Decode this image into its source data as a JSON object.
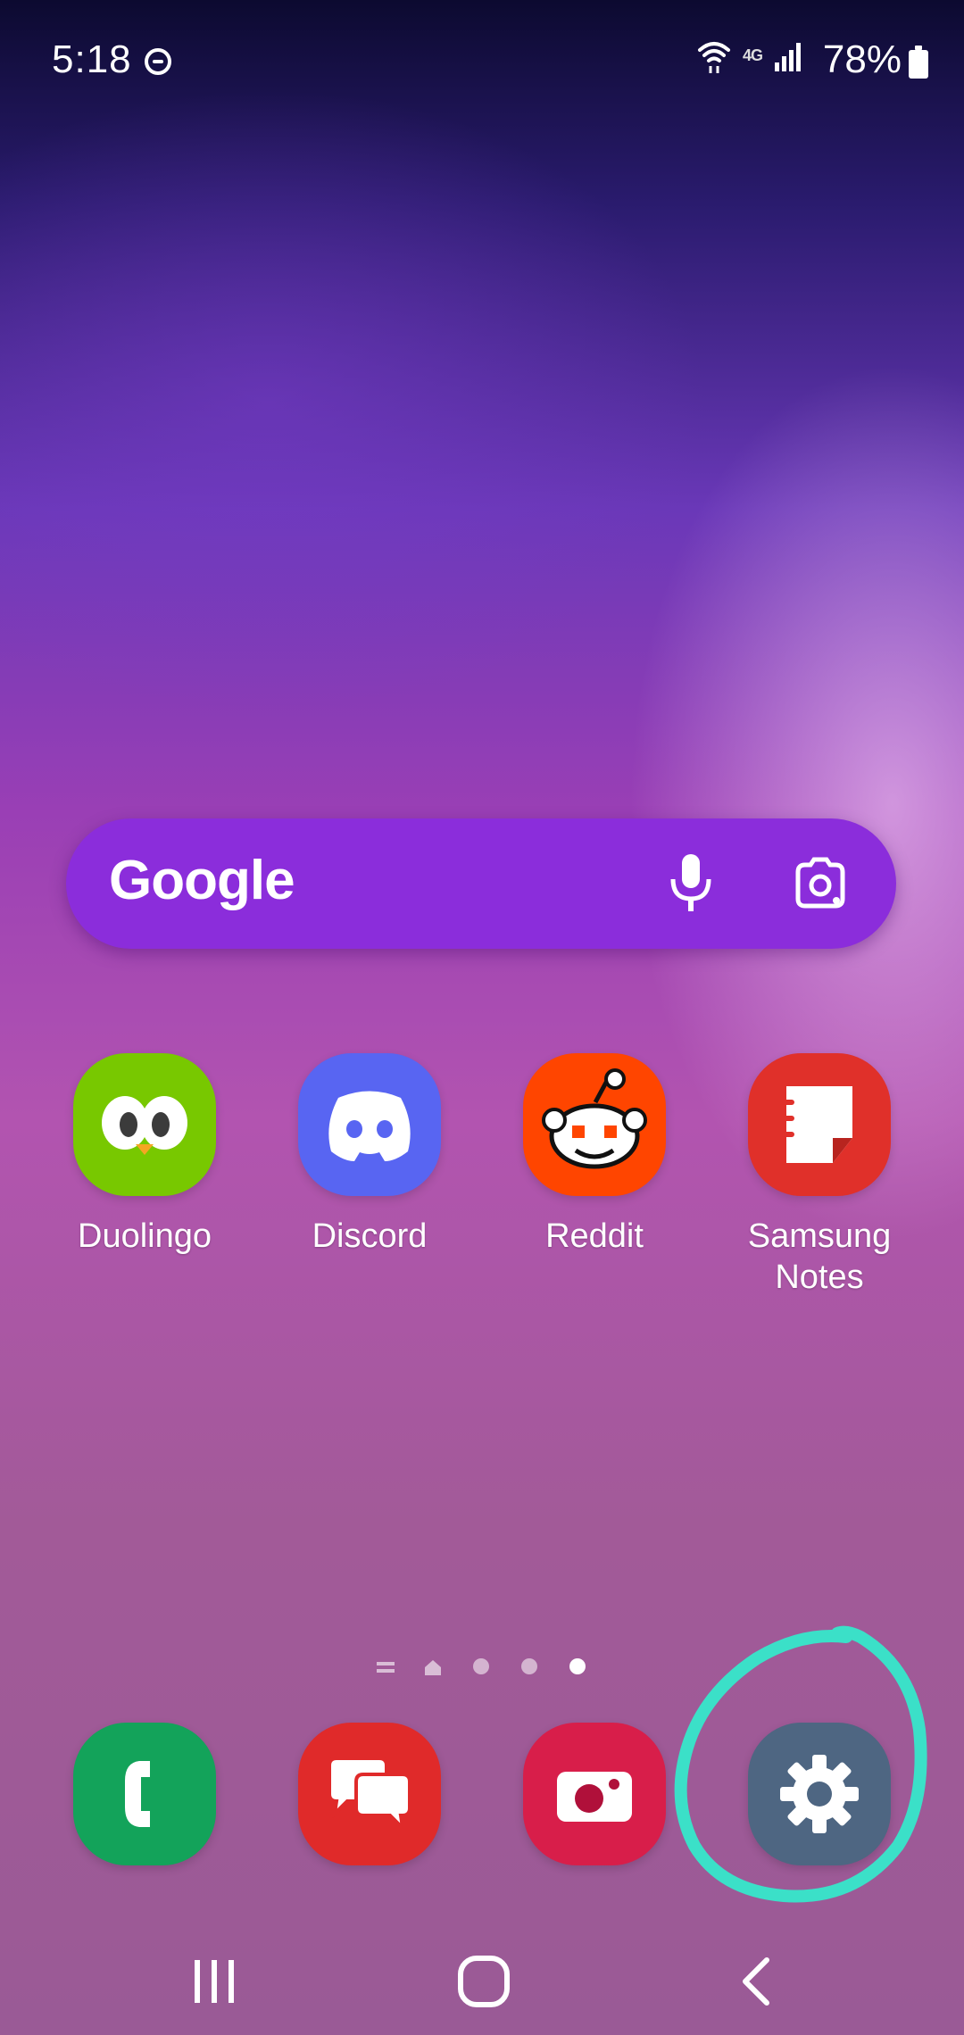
{
  "status_bar": {
    "time": "5:18",
    "battery": "78%",
    "network": "4G",
    "icons": [
      "do-not-disturb-icon",
      "wifi-icon",
      "network-4g-icon",
      "signal-icon",
      "battery-icon"
    ]
  },
  "search": {
    "brand": "Google",
    "icons": [
      "mic-icon",
      "lens-icon"
    ],
    "color": "#8b2ddb"
  },
  "apps": [
    {
      "label": "Duolingo",
      "icon": "duolingo-icon",
      "color": "#78c800"
    },
    {
      "label": "Discord",
      "icon": "discord-icon",
      "color": "#5865f2"
    },
    {
      "label": "Reddit",
      "icon": "reddit-icon",
      "color": "#ff4500"
    },
    {
      "label": "Samsung Notes",
      "icon": "samsung-notes-icon",
      "color": "#e0302a"
    }
  ],
  "page_indicator": {
    "pages": 5,
    "current": 5
  },
  "dock": [
    {
      "name": "phone",
      "icon": "phone-icon",
      "color": "#13a35a"
    },
    {
      "name": "messages",
      "icon": "messages-icon",
      "color": "#e02a2a"
    },
    {
      "name": "camera",
      "icon": "camera-icon",
      "color": "#d81e4a"
    },
    {
      "name": "settings",
      "icon": "settings-icon",
      "color": "#4e6682"
    }
  ],
  "annotation": {
    "color": "#3be0c8"
  },
  "nav_bar": {
    "buttons": [
      "recent-apps-button",
      "home-button",
      "back-button"
    ]
  }
}
